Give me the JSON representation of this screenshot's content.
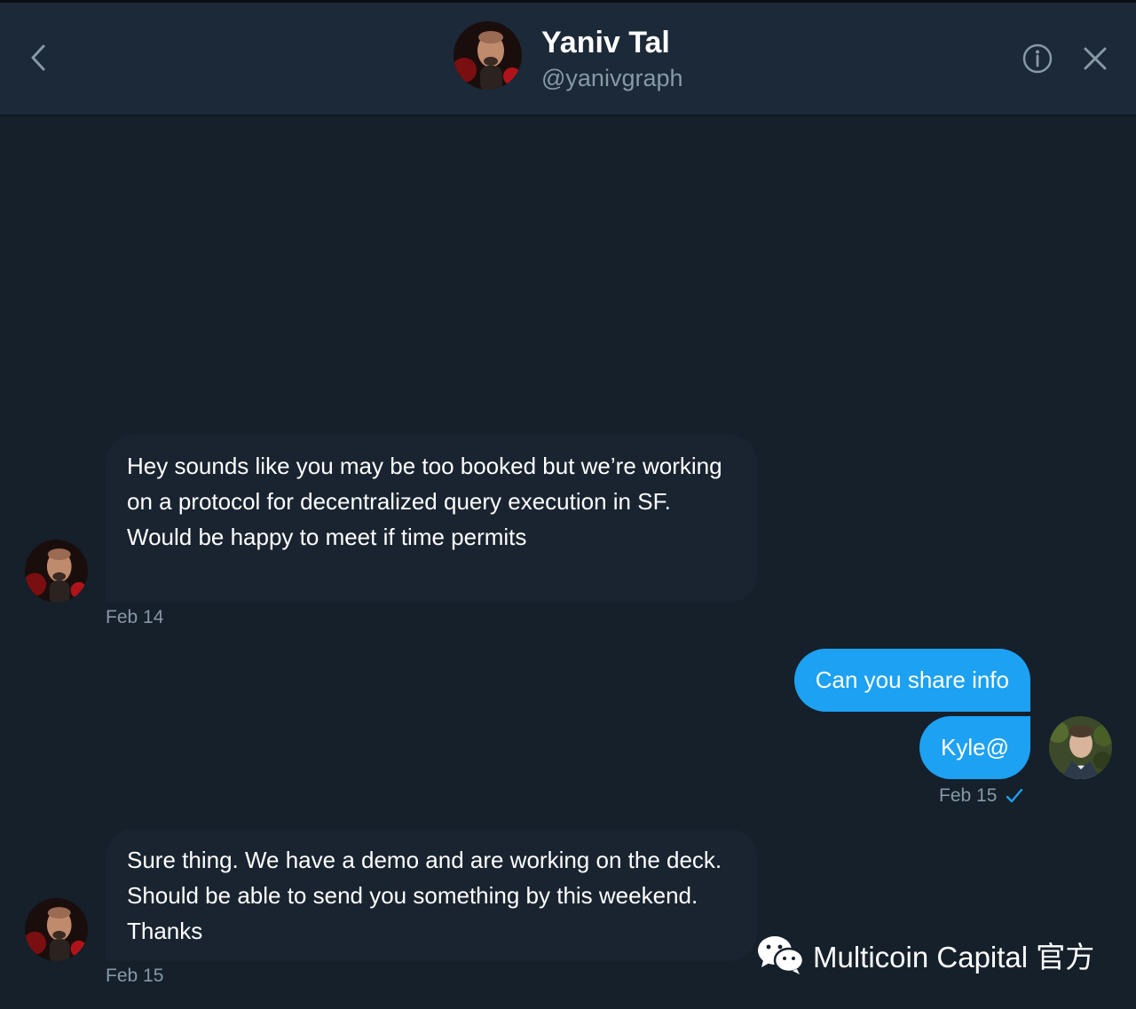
{
  "header": {
    "name": "Yaniv Tal",
    "handle": "@yanivgraph",
    "back_icon": "chevron-left-icon",
    "info_icon": "info-icon",
    "close_icon": "close-icon"
  },
  "messages": [
    {
      "direction": "incoming",
      "text": "Hey sounds like you may be too booked but we’re working on a protocol for decentralized query execution in SF. Would be happy to meet if time permits"
    },
    {
      "direction": "outgoing",
      "text": "Can you share info"
    },
    {
      "direction": "outgoing",
      "text": "Kyle@"
    },
    {
      "direction": "incoming",
      "text": "Sure thing. We have a demo and are working on the deck. Should be able to send you something by this weekend. Thanks"
    }
  ],
  "timestamps": {
    "first": "Feb 14",
    "second": "Feb 15",
    "second_read_icon": "checkmark-icon",
    "third": "Feb 15"
  },
  "watermark": {
    "text": "Multicoin Capital 官方",
    "icon": "wechat-icon"
  },
  "colors": {
    "background": "#15202b",
    "header": "#1c2938",
    "incoming_bubble": "#192430",
    "outgoing_bubble": "#1da1f2",
    "muted_text": "#8899a6"
  }
}
